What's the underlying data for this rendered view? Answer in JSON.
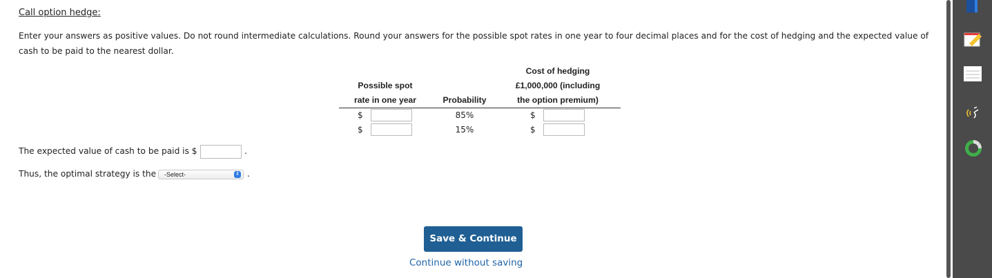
{
  "title": "Call option hedge:",
  "instructions": "Enter your answers as positive values. Do not round intermediate calculations. Round your answers for the possible spot rates in one year to four decimal places and for the cost of hedging and the expected value of cash to be paid to the nearest dollar.",
  "table": {
    "col1_header_line1": "Possible spot",
    "col1_header_line2": "rate in one year",
    "col2_header": "Probability",
    "col3_header_line1": "Cost of hedging",
    "col3_header_line2": "£1,000,000 (including",
    "col3_header_line3": "the option premium)",
    "currency_symbol": "$",
    "rows": [
      {
        "spot_rate": "",
        "probability": "85%",
        "cost": ""
      },
      {
        "spot_rate": "",
        "probability": "15%",
        "cost": ""
      }
    ]
  },
  "expected_value": {
    "label": "The expected value of cash to be paid is $",
    "value": "",
    "period": "."
  },
  "strategy": {
    "label": "Thus, the optimal strategy is the",
    "selected": "-Select-",
    "period": "."
  },
  "buttons": {
    "save_continue": "Save & Continue",
    "continue_without_saving": "Continue without saving"
  },
  "sidebar": {
    "icons": [
      "book-icon",
      "notepad-icon",
      "document-icon",
      "audio-icon",
      "progress-icon"
    ]
  }
}
